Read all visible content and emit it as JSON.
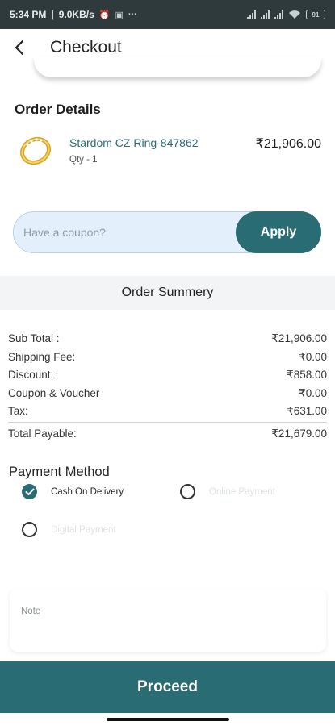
{
  "status_bar": {
    "time": "5:34 PM",
    "speed": "9.0KB/s",
    "extra": "···",
    "battery": "91"
  },
  "header": {
    "title": "Checkout"
  },
  "order_details": {
    "title": "Order Details",
    "items": [
      {
        "name": "Stardom CZ Ring-847862",
        "qty": "Qty - 1",
        "price": "₹21,906.00"
      }
    ]
  },
  "coupon": {
    "placeholder": "Have a coupon?",
    "value": "",
    "apply_label": "Apply"
  },
  "summary": {
    "title": "Order Summery",
    "rows": [
      {
        "label": "Sub Total :",
        "value": "₹21,906.00"
      },
      {
        "label": "Shipping Fee:",
        "value": "₹0.00"
      },
      {
        "label": "Discount:",
        "value": "₹858.00"
      },
      {
        "label": "Coupon & Voucher",
        "value": "₹0.00"
      },
      {
        "label": "Tax:",
        "value": "₹631.00"
      }
    ],
    "total_label": "Total Payable:",
    "total_value": "₹21,679.00"
  },
  "payment": {
    "title": "Payment Method",
    "options": [
      {
        "label": "Cash On Delivery",
        "selected": true
      },
      {
        "label": "Online Payment",
        "selected": false
      },
      {
        "label": "Digital Payment",
        "selected": false
      }
    ]
  },
  "note": {
    "placeholder": "Note",
    "value": ""
  },
  "proceed_label": "Proceed",
  "colors": {
    "accent": "#2a6c73",
    "coupon_bg": "#e3f0fb",
    "status_bar": "#2f3a3c"
  }
}
